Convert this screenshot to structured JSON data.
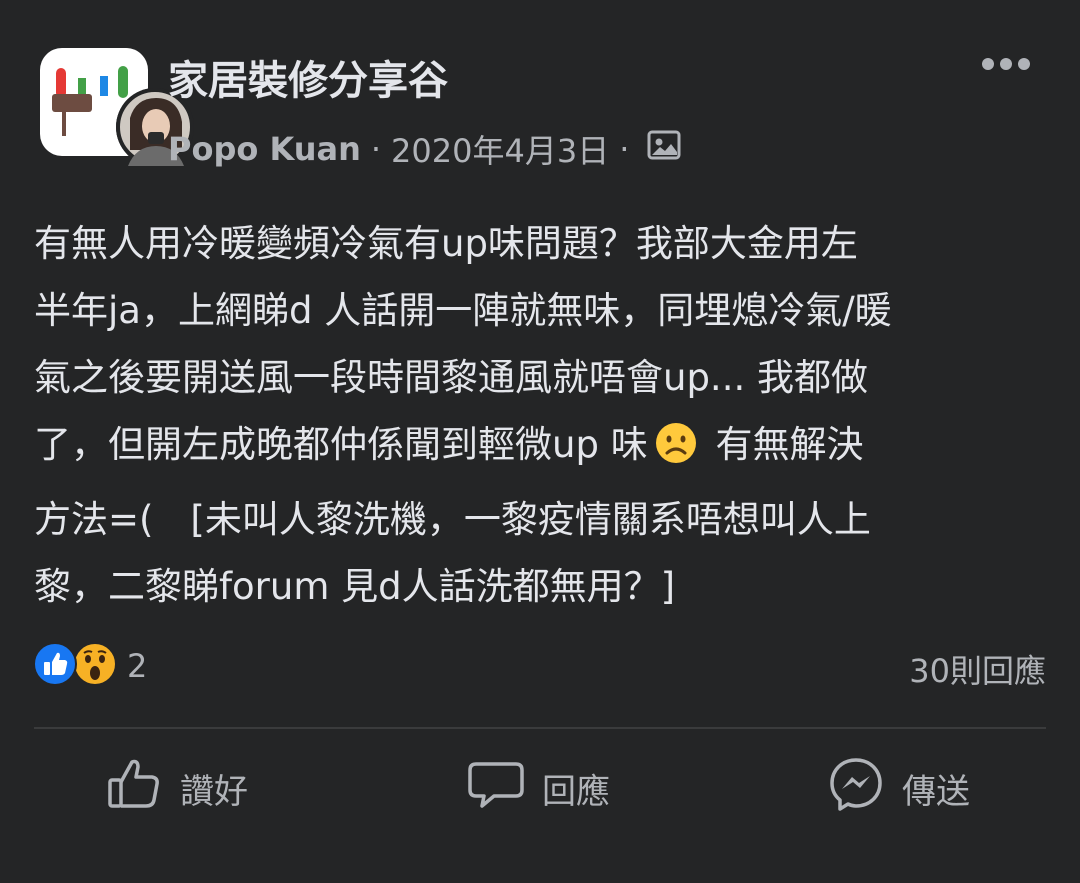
{
  "post": {
    "group_name": "家居裝修分享谷",
    "author": "Popo Kuan",
    "separator": "·",
    "date": "2020年4月3日",
    "privacy_icon": "photo-icon",
    "more_icon": "more-options-icon",
    "body_lines": [
      "有無人用冷暖變頻冷氣有up味問題？我部大金用左",
      "半年ja，上網睇d 人話開一陣就無味，同埋熄冷氣/暖",
      "氣之後要開送風一段時間黎通風就唔會up... 我都做",
      "了，但開左成晚都仲係聞到輕微up 味",
      " 有無解決",
      "方法=(　[未叫人黎洗機，一黎疫情關系唔想叫人上",
      "黎，二黎睇forum 見d人話洗都無用？]"
    ],
    "inline_emoji": "frowning-face-emoji"
  },
  "reactions": {
    "types": [
      "like-reaction-icon",
      "wow-reaction-icon"
    ],
    "count": "2",
    "comments": "30則回應"
  },
  "actions": {
    "like_label": "讚好",
    "comment_label": "回應",
    "share_label": "傳送"
  },
  "colors": {
    "background": "#242526",
    "text": "#e4e6eb",
    "secondary_text": "#b0b3b8",
    "like_blue": "#1877f2",
    "divider": "#3a3b3c"
  }
}
